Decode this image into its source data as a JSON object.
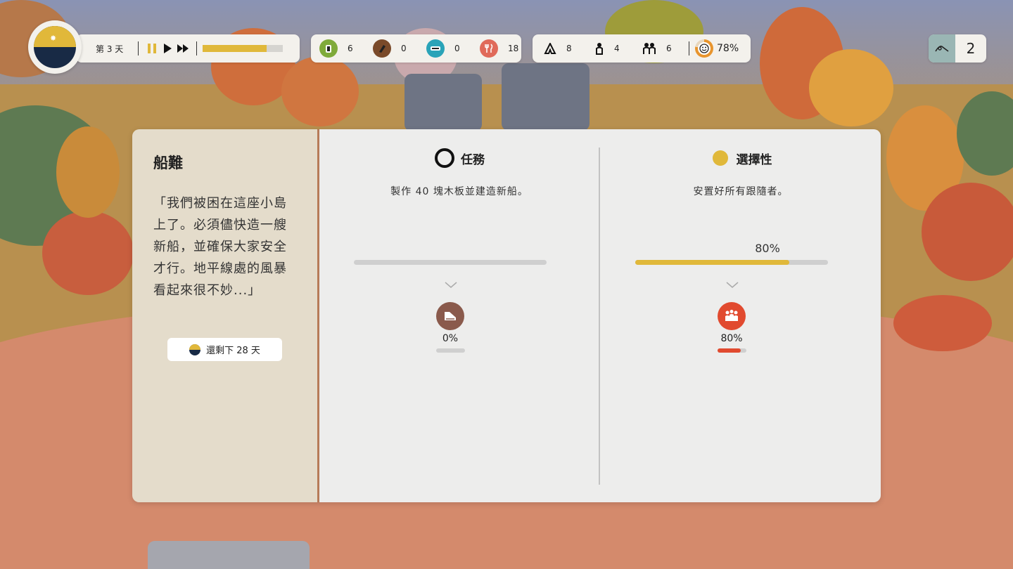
{
  "hud": {
    "day_label": "第 3 天",
    "day_progress": 0.8,
    "resources": [
      {
        "name": "food-stock",
        "value": "6",
        "color": "#7faa3a"
      },
      {
        "name": "wood",
        "value": "0",
        "color": "#7a4a2a"
      },
      {
        "name": "planks",
        "value": "0",
        "color": "#2aa3b8"
      },
      {
        "name": "meals",
        "value": "18",
        "color": "#e06a5a"
      }
    ],
    "population": [
      {
        "name": "tents",
        "value": "8"
      },
      {
        "name": "workers",
        "value": "4"
      },
      {
        "name": "families",
        "value": "6"
      }
    ],
    "happiness": "78%",
    "happiness_value": 0.78,
    "count": "2"
  },
  "story": {
    "title": "船難",
    "text": "「我們被困在這座小島上了。必須儘快造一艘新船，並確保大家安全才行。地平線處的風暴看起來很不妙...」",
    "days_left": "還剩下 28 天"
  },
  "goals": {
    "main": {
      "heading": "任務",
      "description": "製作 40 塊木板並建造新船。",
      "progress": 0,
      "sub_pct": "0%",
      "sub_progress": 0,
      "sub_icon_color": "#8a5a4c"
    },
    "optional": {
      "heading": "選擇性",
      "description": "安置好所有跟隨者。",
      "pct": "80%",
      "progress": 0.8,
      "sub_pct": "80%",
      "sub_progress": 0.8,
      "sub_icon_color": "#e14a2f",
      "accent": "#e0b83a"
    }
  }
}
